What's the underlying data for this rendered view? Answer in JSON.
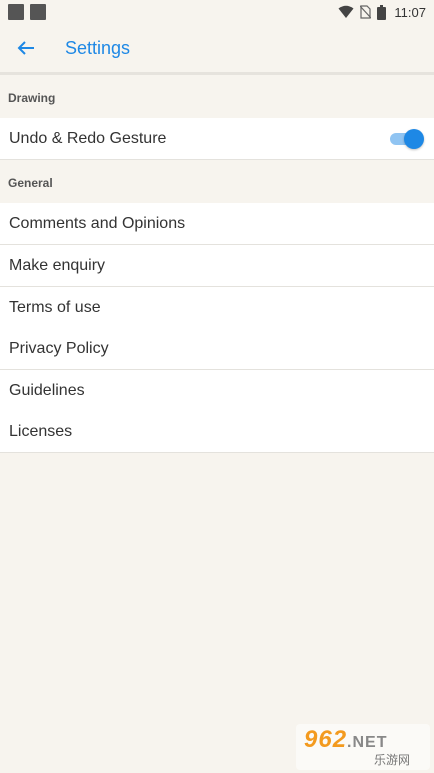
{
  "status_bar": {
    "time": "11:07",
    "icons": [
      "notification-square-icon",
      "notification-square-icon",
      "wifi-icon",
      "no-sim-icon",
      "battery-icon"
    ]
  },
  "app_bar": {
    "title": "Settings",
    "back_icon": "back-arrow-icon"
  },
  "sections": {
    "drawing": {
      "header": "Drawing",
      "items": [
        {
          "label": "Undo & Redo Gesture",
          "toggle_on": true
        }
      ]
    },
    "general": {
      "header": "General",
      "items": [
        {
          "label": "Comments and Opinions"
        },
        {
          "label": "Make enquiry"
        },
        {
          "label": "Terms of use"
        },
        {
          "label": "Privacy Policy"
        },
        {
          "label": "Guidelines"
        },
        {
          "label": "Licenses"
        }
      ]
    }
  },
  "watermark": {
    "brand": "962",
    "domain": ".NET",
    "subtitle": "乐游网"
  },
  "colors": {
    "accent": "#1e88e5",
    "background": "#f7f4ee",
    "row_background": "#ffffff",
    "toggle_track": "#90c4f2"
  }
}
